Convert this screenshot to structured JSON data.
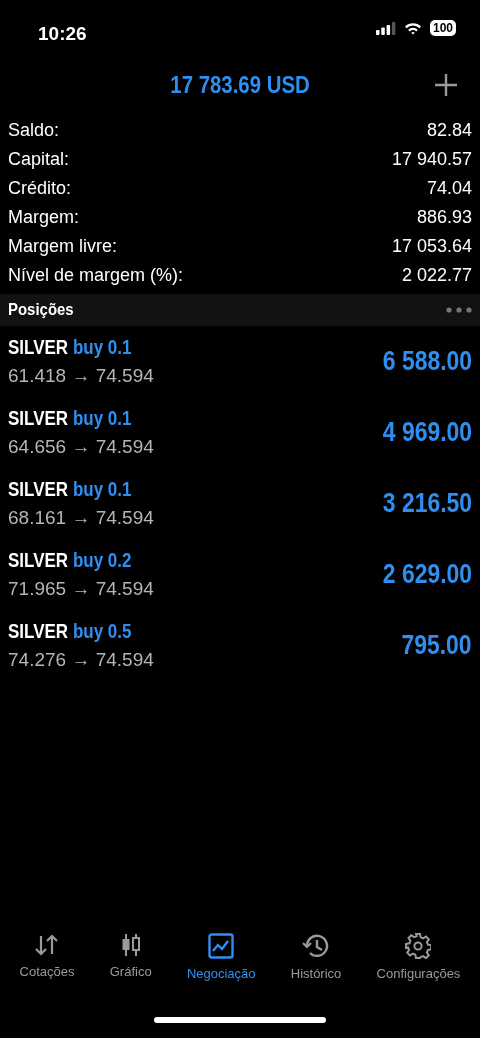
{
  "status_bar": {
    "time": "10:26",
    "battery": "100"
  },
  "header": {
    "balance_title": "17 783.69 USD"
  },
  "summary": [
    {
      "label": "Saldo:",
      "value": "82.84"
    },
    {
      "label": "Capital:",
      "value": "17 940.57"
    },
    {
      "label": "Crédito:",
      "value": "74.04"
    },
    {
      "label": "Margem:",
      "value": "886.93"
    },
    {
      "label": "Margem livre:",
      "value": "17 053.64"
    },
    {
      "label": "Nível de margem (%):",
      "value": "2 022.77"
    }
  ],
  "positions_section": {
    "title": "Posições"
  },
  "positions": [
    {
      "symbol": "SILVER",
      "order": "buy 0.1",
      "prices": "61.418 → 74.594",
      "profit": "6 588.00"
    },
    {
      "symbol": "SILVER",
      "order": "buy 0.1",
      "prices": "64.656 → 74.594",
      "profit": "4 969.00"
    },
    {
      "symbol": "SILVER",
      "order": "buy 0.1",
      "prices": "68.161 → 74.594",
      "profit": "3 216.50"
    },
    {
      "symbol": "SILVER",
      "order": "buy 0.2",
      "prices": "71.965 → 74.594",
      "profit": "2 629.00"
    },
    {
      "symbol": "SILVER",
      "order": "buy 0.5",
      "prices": "74.276 → 74.594",
      "profit": "795.00"
    }
  ],
  "tab_bar": [
    {
      "label": "Cotações",
      "selected": false
    },
    {
      "label": "Gráfico",
      "selected": false
    },
    {
      "label": "Negociação",
      "selected": true
    },
    {
      "label": "Histórico",
      "selected": false
    },
    {
      "label": "Configurações",
      "selected": false
    }
  ]
}
